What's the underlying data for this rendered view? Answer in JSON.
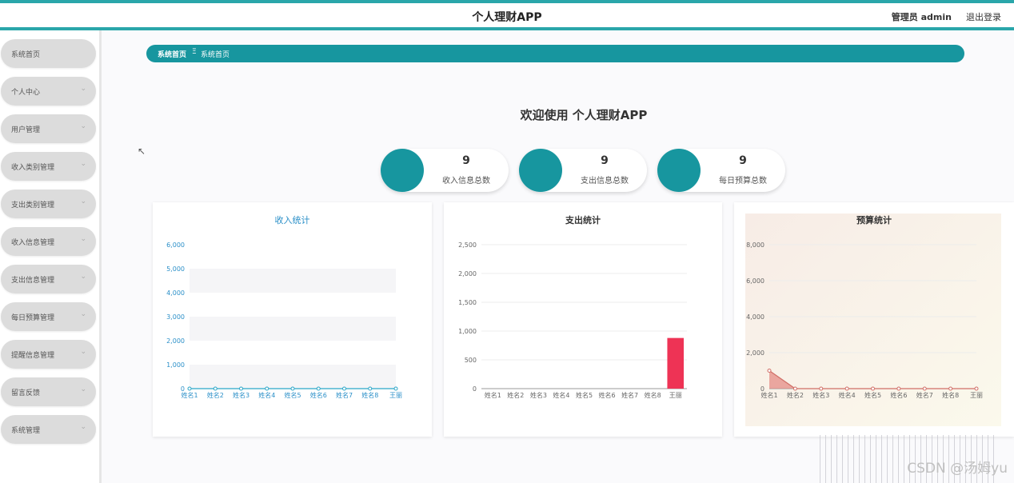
{
  "header": {
    "title": "个人理财APP",
    "admin": "管理员 admin",
    "logout": "退出登录"
  },
  "sidebar": {
    "items": [
      {
        "label": "系统首页",
        "chevron": false
      },
      {
        "label": "个人中心",
        "chevron": true
      },
      {
        "label": "用户管理",
        "chevron": true
      },
      {
        "label": "收入类别管理",
        "chevron": true
      },
      {
        "label": "支出类别管理",
        "chevron": true
      },
      {
        "label": "收入信息管理",
        "chevron": true
      },
      {
        "label": "支出信息管理",
        "chevron": true
      },
      {
        "label": "每日预算管理",
        "chevron": true
      },
      {
        "label": "提醒信息管理",
        "chevron": true
      },
      {
        "label": "留言反馈",
        "chevron": true
      },
      {
        "label": "系统管理",
        "chevron": true
      }
    ]
  },
  "breadcrumb": {
    "home": "系统首页",
    "separator": "Ξ",
    "current": "系统首页"
  },
  "welcome": "欢迎使用 个人理财APP",
  "stats": [
    {
      "value": "9",
      "label": "收入信息总数"
    },
    {
      "value": "9",
      "label": "支出信息总数"
    },
    {
      "value": "9",
      "label": "每日预算总数"
    }
  ],
  "colors": {
    "accent": "#17969f",
    "topbar_border": "#2aa6aa",
    "expense_bar": "#ee3355",
    "budget_area": "#e48c85"
  },
  "chart_data": [
    {
      "type": "line",
      "title": "收入统计",
      "categories": [
        "姓名1",
        "姓名2",
        "姓名3",
        "姓名4",
        "姓名5",
        "姓名6",
        "姓名7",
        "姓名8",
        "王丽"
      ],
      "values": [
        0,
        0,
        0,
        0,
        0,
        0,
        0,
        0,
        0
      ],
      "yticks": [
        "0",
        "1,000",
        "2,000",
        "3,000",
        "4,000",
        "5,000",
        "6,000"
      ],
      "ylim": [
        0,
        6000
      ],
      "grid": "striped"
    },
    {
      "type": "bar",
      "title": "支出统计",
      "categories": [
        "姓名1",
        "姓名2",
        "姓名3",
        "姓名4",
        "姓名5",
        "姓名6",
        "姓名7",
        "姓名8",
        "王丽"
      ],
      "values": [
        0,
        0,
        0,
        0,
        0,
        0,
        0,
        0,
        880
      ],
      "yticks": [
        "0",
        "500",
        "1,000",
        "1,500",
        "2,000",
        "2,500"
      ],
      "ylim": [
        0,
        2500
      ],
      "grid": true
    },
    {
      "type": "area",
      "title": "预算统计",
      "categories": [
        "姓名1",
        "姓名2",
        "姓名3",
        "姓名4",
        "姓名5",
        "姓名6",
        "姓名7",
        "姓名8",
        "王丽"
      ],
      "values": [
        1000,
        0,
        0,
        0,
        0,
        0,
        0,
        0,
        0
      ],
      "yticks": [
        "0",
        "2,000",
        "4,000",
        "6,000",
        "8,000"
      ],
      "ylim": [
        0,
        8000
      ],
      "grid": true
    }
  ]
}
